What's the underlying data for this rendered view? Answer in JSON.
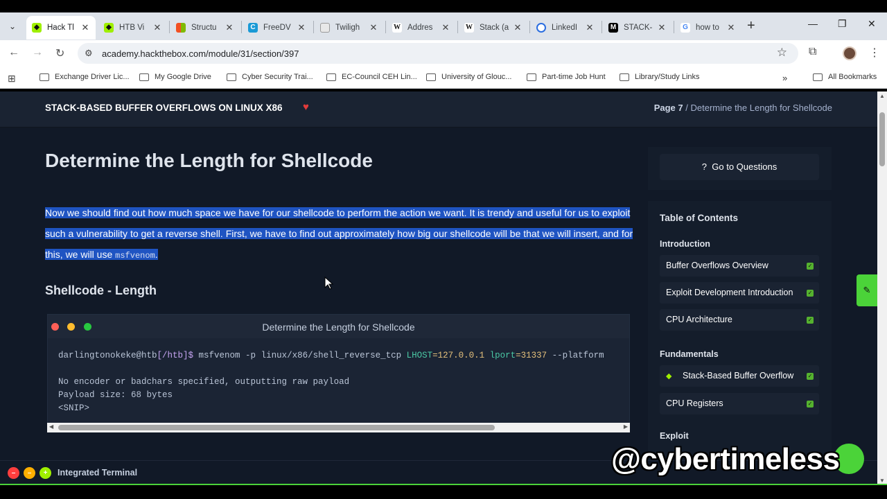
{
  "browser": {
    "tabs": [
      {
        "title": "Hack Tl",
        "active": true,
        "fav_color": "#9fef00",
        "fav_glyph": "◆"
      },
      {
        "title": "HTB Vi",
        "active": false,
        "fav_color": "#9fef00",
        "fav_glyph": "◆"
      },
      {
        "title": "Structu",
        "active": false,
        "fav_color": "#f25022",
        "fav_glyph": "▦"
      },
      {
        "title": "FreeDV",
        "active": false,
        "fav_color": "#1a9ad6",
        "fav_glyph": "C"
      },
      {
        "title": "Twiligh",
        "active": false,
        "fav_color": "#dddddd",
        "fav_glyph": "▯"
      },
      {
        "title": "Addres",
        "active": false,
        "fav_color": "#ffffff",
        "fav_glyph": "W"
      },
      {
        "title": "Stack (a",
        "active": false,
        "fav_color": "#ffffff",
        "fav_glyph": "W"
      },
      {
        "title": "LinkedI",
        "active": false,
        "fav_color": "#2a6de0",
        "fav_glyph": "G"
      },
      {
        "title": "STACK-",
        "active": false,
        "fav_color": "#000000",
        "fav_glyph": "M"
      },
      {
        "title": "how to",
        "active": false,
        "fav_color": "#ffffff",
        "fav_glyph": "G"
      }
    ],
    "url": "academy.hackthebox.com/module/31/section/397",
    "bookmarks": [
      "Exchange Driver Lic...",
      "My Google Drive",
      "Cyber Security Trai...",
      "EC-Council CEH Lin...",
      "University of Glouc...",
      "Part-time Job Hunt",
      "Library/Study Links"
    ],
    "all_bookmarks": "All Bookmarks"
  },
  "module": {
    "title": "STACK-BASED BUFFER OVERFLOWS ON LINUX X86",
    "page_label": "Page 7",
    "crumb_sep": "/",
    "section_crumb": "Determine the Length for Shellcode"
  },
  "article": {
    "heading": "Determine the Length for Shellcode",
    "paragraph": "Now we should find out how much space we have for our shellcode to perform the action we want. It is trendy and useful for us to exploit such a vulnerability to get a reverse shell. First, we have to find out approximately how big our shellcode will be that we will insert, and for this, we will use",
    "paragraph_code": "msfvenom",
    "paragraph_end": ".",
    "subheading": "Shellcode - Length"
  },
  "terminal": {
    "title": "Determine the Length for Shellcode",
    "prompt_user": "darlingtonokeke@htb",
    "prompt_path": "[/htb]$",
    "cmd_a": " msfvenom -p linux/x86/shell_reverse_tcp ",
    "lhost_key": "LHOST",
    "lhost_val": "=127.0.0.1 ",
    "lport_key": "lport",
    "lport_val": "=31337",
    "cmd_b": " --platform",
    "out1": "No encoder or badchars specified, outputting raw payload",
    "out2": "Payload size: 68 bytes",
    "out3": "<SNIP>"
  },
  "sidebar": {
    "go_questions": "Go to Questions",
    "toc_title": "Table of Contents",
    "sections": [
      {
        "name": "Introduction",
        "items": [
          "Buffer Overflows Overview",
          "Exploit Development Introduction",
          "CPU Architecture"
        ]
      },
      {
        "name": "Fundamentals",
        "items": [
          "Stack-Based Buffer Overflow",
          "CPU Registers"
        ]
      },
      {
        "name": "Exploit",
        "items": []
      }
    ]
  },
  "footer": {
    "terminal_label": "Integrated Terminal"
  },
  "watermark": "@cybertimeless",
  "colors": {
    "accent_green": "#9fef00",
    "page_bg": "#141d2b",
    "highlight": "#1f54c2",
    "heart": "#e23b3b"
  }
}
